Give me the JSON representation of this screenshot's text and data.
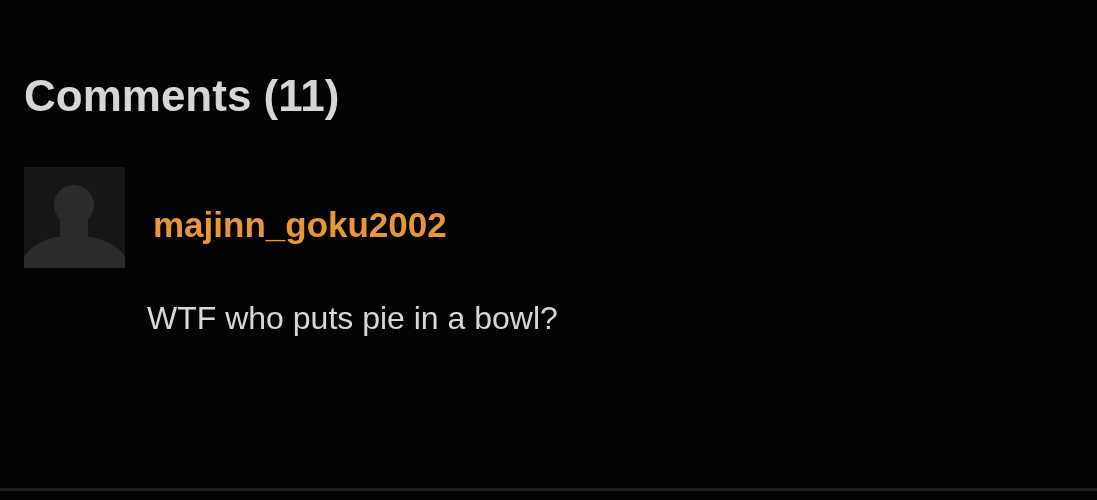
{
  "heading": "Comments (11)",
  "comments": [
    {
      "username": "majinn_goku2002",
      "text": "WTF who puts pie in a bowl?"
    }
  ]
}
